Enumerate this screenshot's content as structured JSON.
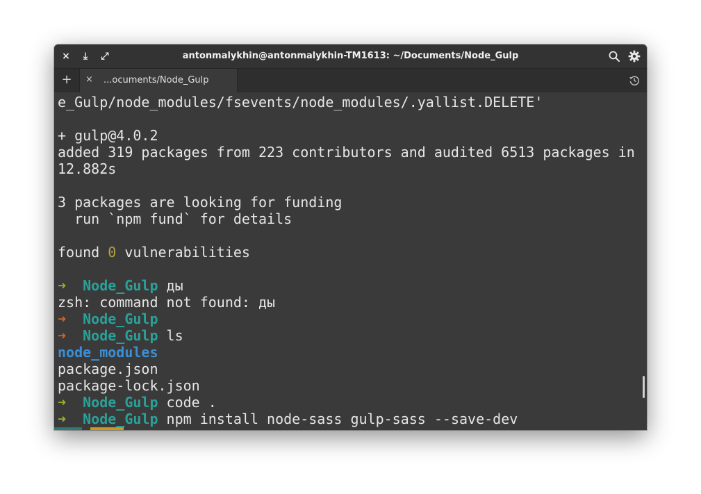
{
  "window": {
    "title": "antonmalykhin@antonmalykhin-TM1613: ~/Documents/Node_Gulp",
    "buttons": {
      "close": "×",
      "minimize": "⤓",
      "maximize": "⤢"
    }
  },
  "tabs": {
    "new_tab": "+",
    "items": [
      {
        "close": "×",
        "label": "...ocuments/Node_Gulp"
      }
    ]
  },
  "terminal": {
    "lines": [
      {
        "text": "e_Gulp/node_modules/fsevents/node_modules/.yallist.DELETE'"
      },
      {
        "text": ""
      },
      {
        "text": "+ gulp@4.0.2"
      },
      {
        "text": "added 319 packages from 223 contributors and audited 6513 packages in"
      },
      {
        "text": "12.882s"
      },
      {
        "text": ""
      },
      {
        "text": "3 packages are looking for funding"
      },
      {
        "text": "  run `npm fund` for details"
      },
      {
        "text": ""
      },
      {
        "pre": "found ",
        "num": "0",
        "post": " vulnerabilities"
      },
      {
        "text": ""
      },
      {
        "prompt": "➜",
        "status": "ok",
        "dir": "Node_Gulp",
        "cmd": " ды"
      },
      {
        "text": "zsh: command not found: ды"
      },
      {
        "prompt": "➜",
        "status": "err",
        "dir": "Node_Gulp",
        "cmd": ""
      },
      {
        "prompt": "➜",
        "status": "err",
        "dir": "Node_Gulp",
        "cmd": " ls"
      },
      {
        "folder": "node_modules"
      },
      {
        "text": "package.json"
      },
      {
        "text": "package-lock.json"
      },
      {
        "prompt": "➜",
        "status": "ok",
        "dir": "Node_Gulp",
        "cmd": " code ."
      },
      {
        "prompt": "➜",
        "status": "ok",
        "dir": "Node_Gulp",
        "cmd": " npm install node-sass gulp-sass --save-dev"
      }
    ]
  },
  "icons": {
    "history": "history-icon"
  },
  "colors": {
    "background": "#3a3a3a",
    "foreground": "#e6e6e6",
    "prompt_ok": "#9bb02b",
    "prompt_err": "#d2622a",
    "directory": "#2aa198",
    "folder": "#3b8fd6",
    "number": "#b7a33c"
  }
}
